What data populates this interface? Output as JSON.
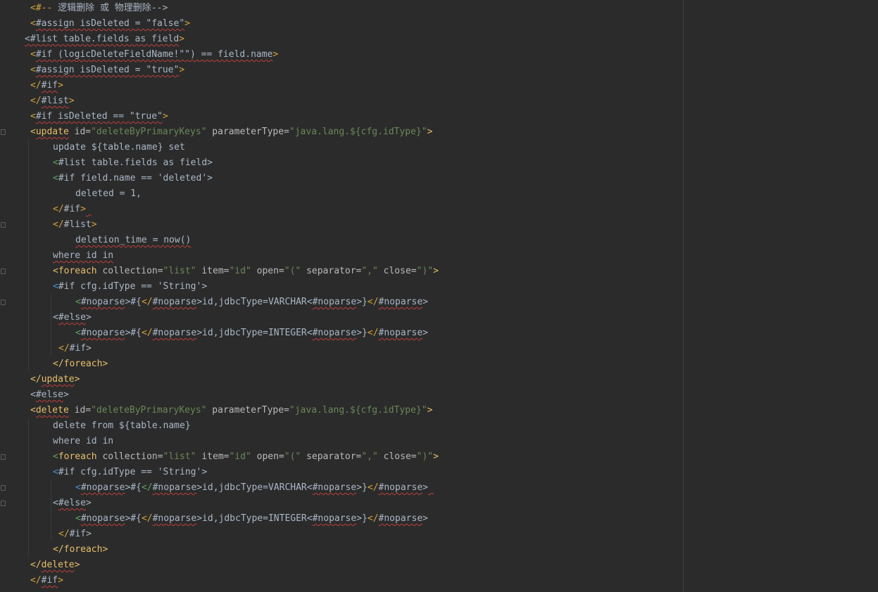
{
  "editor": {
    "lines": [
      {
        "indent": 43,
        "segs": [
          [
            "<#-- ",
            "t-ftlbr-gold"
          ],
          [
            "逻辑删除 或 物理删除",
            "t-plain"
          ],
          [
            "-->",
            "t-plain"
          ]
        ]
      },
      {
        "indent": 43,
        "segs": [
          [
            "<",
            "t-ftlbr-gold"
          ],
          [
            "#assign isDeleted = \"false\"",
            "t-plain sq"
          ],
          [
            ">",
            "t-ftlbr-gold"
          ]
        ]
      },
      {
        "indent": 35,
        "segs": [
          [
            "<#list table.fields as field",
            "t-plain sq"
          ],
          [
            ">",
            "t-ftlbr-gold"
          ]
        ]
      },
      {
        "indent": 43,
        "segs": [
          [
            "<",
            "t-ftlbr-gold"
          ],
          [
            "#if (logicDeleteFieldName!\"\") == field.name",
            "t-plain sq"
          ],
          [
            ">",
            "t-ftlbr-gold"
          ]
        ]
      },
      {
        "indent": 43,
        "segs": [
          [
            "<",
            "t-ftlbr-gold"
          ],
          [
            "#assign isDeleted = \"true\"",
            "t-plain sq"
          ],
          [
            ">",
            "t-ftlbr-gold"
          ]
        ]
      },
      {
        "indent": 43,
        "segs": [
          [
            "</",
            "t-ftlbr-gold"
          ],
          [
            "#if",
            "t-plain sq"
          ],
          [
            ">",
            "t-ftlbr-gold"
          ]
        ]
      },
      {
        "indent": 43,
        "segs": [
          [
            "</",
            "t-ftlbr-gold"
          ],
          [
            "#list",
            "t-plain sq"
          ],
          [
            ">",
            "t-ftlbr-gold"
          ]
        ]
      },
      {
        "indent": 43,
        "segs": [
          [
            "<",
            "t-ftlbr-gold"
          ],
          [
            "#if isDeleted == \"true\"",
            "t-plain sq"
          ],
          [
            ">",
            "t-ftlbr-gold"
          ]
        ]
      },
      {
        "indent": 43,
        "segs": [
          [
            "<",
            "t-tag"
          ],
          [
            "update",
            "t-tag sq"
          ],
          [
            " id=",
            "t-attr"
          ],
          [
            "\"deleteByPrimaryKeys\"",
            "t-str"
          ],
          [
            " parameterType=",
            "t-attr"
          ],
          [
            "\"java.lang.${cfg.idType}\"",
            "t-str"
          ],
          [
            ">",
            "t-tag"
          ]
        ]
      },
      {
        "indent": 75,
        "segs": [
          [
            "update ${table.name} set",
            "t-plain"
          ]
        ]
      },
      {
        "indent": 75,
        "segs": [
          [
            "<",
            "t-ftlbr-green"
          ],
          [
            "#list table.fields as field",
            "t-plain"
          ],
          [
            ">",
            "t-plain"
          ]
        ]
      },
      {
        "indent": 75,
        "segs": [
          [
            "<",
            "t-ftlbr-green"
          ],
          [
            "#if field.name == 'deleted'",
            "t-plain"
          ],
          [
            ">",
            "t-plain"
          ]
        ]
      },
      {
        "indent": 107,
        "segs": [
          [
            "deleted = 1,",
            "t-plain"
          ]
        ]
      },
      {
        "indent": 75,
        "segs": [
          [
            "</",
            "t-ftlbr-gold"
          ],
          [
            "#if",
            "t-plain"
          ],
          [
            ">",
            "t-ftlbr-gold"
          ],
          [
            " ",
            "t-plain sq"
          ]
        ]
      },
      {
        "indent": 75,
        "segs": [
          [
            "</",
            "t-ftlbr-gold"
          ],
          [
            "#list",
            "t-plain"
          ],
          [
            ">",
            "t-ftlbr-gold"
          ]
        ]
      },
      {
        "indent": 107,
        "segs": [
          [
            "deletion_time = now()",
            "t-plain sq"
          ]
        ]
      },
      {
        "indent": 75,
        "segs": [
          [
            "where id in",
            "t-plain sq"
          ]
        ]
      },
      {
        "indent": 75,
        "segs": [
          [
            "<",
            "t-tag"
          ],
          [
            "foreach",
            "t-tag"
          ],
          [
            " collection=",
            "t-attr"
          ],
          [
            "\"list\"",
            "t-str"
          ],
          [
            " item=",
            "t-attr"
          ],
          [
            "\"id\"",
            "t-str"
          ],
          [
            " open=",
            "t-attr"
          ],
          [
            "\"(\"",
            "t-str"
          ],
          [
            " separator=",
            "t-attr"
          ],
          [
            "\",\"",
            "t-str"
          ],
          [
            " close=",
            "t-attr"
          ],
          [
            "\")\"",
            "t-str"
          ],
          [
            ">",
            "t-tag"
          ]
        ]
      },
      {
        "indent": 75,
        "segs": [
          [
            "<",
            "t-ftlbr-blue"
          ],
          [
            "#if cfg.idType == 'String'",
            "t-plain"
          ],
          [
            ">",
            "t-plain"
          ]
        ]
      },
      {
        "indent": 107,
        "segs": [
          [
            "<",
            "t-ftlbr-green"
          ],
          [
            "#noparse",
            "t-plain sq"
          ],
          [
            ">#{",
            "t-plain"
          ],
          [
            "</",
            "t-ftlbr-gold"
          ],
          [
            "#noparse",
            "t-plain sq"
          ],
          [
            ">id,jdbcType=VARCHAR",
            "t-plain"
          ],
          [
            "<",
            "t-plain"
          ],
          [
            "#noparse",
            "t-plain sq"
          ],
          [
            ">}",
            "t-plain"
          ],
          [
            "</",
            "t-ftlbr-gold"
          ],
          [
            "#noparse",
            "t-plain sq"
          ],
          [
            ">",
            "t-plain"
          ]
        ]
      },
      {
        "indent": 75,
        "segs": [
          [
            "<",
            "t-plain"
          ],
          [
            "#else",
            "t-plain sq"
          ],
          [
            ">",
            "t-plain"
          ]
        ]
      },
      {
        "indent": 107,
        "segs": [
          [
            "<",
            "t-ftlbr-green"
          ],
          [
            "#noparse",
            "t-plain sq"
          ],
          [
            ">#{",
            "t-plain"
          ],
          [
            "</",
            "t-ftlbr-gold"
          ],
          [
            "#noparse",
            "t-plain sq"
          ],
          [
            ">id,jdbcType=INTEGER",
            "t-plain"
          ],
          [
            "<",
            "t-plain"
          ],
          [
            "#noparse",
            "t-plain sq"
          ],
          [
            ">}",
            "t-plain"
          ],
          [
            "</",
            "t-ftlbr-gold"
          ],
          [
            "#noparse",
            "t-plain sq"
          ],
          [
            ">",
            "t-plain"
          ]
        ]
      },
      {
        "indent": 83,
        "segs": [
          [
            "</",
            "t-ftlbr-gold"
          ],
          [
            "#if",
            "t-plain"
          ],
          [
            ">",
            "t-plain"
          ]
        ]
      },
      {
        "indent": 75,
        "segs": [
          [
            "</",
            "t-tag"
          ],
          [
            "foreach",
            "t-tag"
          ],
          [
            ">",
            "t-tag"
          ]
        ]
      },
      {
        "indent": 43,
        "segs": [
          [
            "</",
            "t-tag"
          ],
          [
            "update",
            "t-tag sq"
          ],
          [
            ">",
            "t-tag"
          ]
        ]
      },
      {
        "indent": 43,
        "segs": [
          [
            "<",
            "t-plain"
          ],
          [
            "#else",
            "t-plain sq"
          ],
          [
            ">",
            "t-plain"
          ]
        ]
      },
      {
        "indent": 43,
        "segs": [
          [
            "<",
            "t-tag"
          ],
          [
            "delete",
            "t-tag sq"
          ],
          [
            " id=",
            "t-attr"
          ],
          [
            "\"deleteByPrimaryKeys\"",
            "t-str"
          ],
          [
            " parameterType=",
            "t-attr"
          ],
          [
            "\"java.lang.${cfg.idType}\"",
            "t-str"
          ],
          [
            ">",
            "t-tag"
          ]
        ]
      },
      {
        "indent": 75,
        "segs": [
          [
            "delete from ${table.name}",
            "t-plain"
          ]
        ]
      },
      {
        "indent": 75,
        "segs": [
          [
            "where id in",
            "t-plain"
          ]
        ]
      },
      {
        "indent": 75,
        "segs": [
          [
            "<",
            "t-ftlbr-green"
          ],
          [
            "foreach",
            "t-tag"
          ],
          [
            " collection=",
            "t-attr"
          ],
          [
            "\"list\"",
            "t-str"
          ],
          [
            " item=",
            "t-attr"
          ],
          [
            "\"id\"",
            "t-str"
          ],
          [
            " open=",
            "t-attr"
          ],
          [
            "\"(\"",
            "t-str"
          ],
          [
            " separator=",
            "t-attr"
          ],
          [
            "\",\"",
            "t-str"
          ],
          [
            " close=",
            "t-attr"
          ],
          [
            "\")\"",
            "t-str"
          ],
          [
            ">",
            "t-tag"
          ]
        ]
      },
      {
        "indent": 75,
        "segs": [
          [
            "<",
            "t-ftlbr-blue"
          ],
          [
            "#if cfg.idType == 'String'",
            "t-plain"
          ],
          [
            ">",
            "t-plain"
          ]
        ]
      },
      {
        "indent": 107,
        "segs": [
          [
            "<",
            "t-ftlbr-blue"
          ],
          [
            "#noparse",
            "t-plain sq"
          ],
          [
            ">#{",
            "t-plain"
          ],
          [
            "</",
            "t-ftlbr-green"
          ],
          [
            "#noparse",
            "t-plain sq"
          ],
          [
            ">id,jdbcType=VARCHAR",
            "t-plain"
          ],
          [
            "<",
            "t-plain"
          ],
          [
            "#noparse",
            "t-plain sq"
          ],
          [
            ">}",
            "t-plain"
          ],
          [
            "</",
            "t-ftlbr-gold"
          ],
          [
            "#noparse",
            "t-plain sq"
          ],
          [
            ">",
            "t-plain"
          ],
          [
            " ",
            "t-plain sq"
          ]
        ]
      },
      {
        "indent": 75,
        "segs": [
          [
            "<",
            "t-plain"
          ],
          [
            "#else",
            "t-plain sq"
          ],
          [
            ">",
            "t-plain"
          ]
        ]
      },
      {
        "indent": 107,
        "segs": [
          [
            "<",
            "t-ftlbr-green"
          ],
          [
            "#noparse",
            "t-plain sq"
          ],
          [
            ">#{",
            "t-plain"
          ],
          [
            "</",
            "t-ftlbr-gold"
          ],
          [
            "#noparse",
            "t-plain sq"
          ],
          [
            ">id,jdbcType=INTEGER",
            "t-plain"
          ],
          [
            "<",
            "t-plain"
          ],
          [
            "#noparse",
            "t-plain sq"
          ],
          [
            ">}",
            "t-plain"
          ],
          [
            "</",
            "t-ftlbr-gold"
          ],
          [
            "#noparse",
            "t-plain sq"
          ],
          [
            ">",
            "t-plain"
          ]
        ]
      },
      {
        "indent": 83,
        "segs": [
          [
            "</",
            "t-ftlbr-gold"
          ],
          [
            "#if",
            "t-plain"
          ],
          [
            ">",
            "t-plain"
          ]
        ]
      },
      {
        "indent": 75,
        "segs": [
          [
            "</",
            "t-tag"
          ],
          [
            "foreach",
            "t-tag"
          ],
          [
            ">",
            "t-tag"
          ]
        ]
      },
      {
        "indent": 43,
        "segs": [
          [
            "</",
            "t-tag"
          ],
          [
            "delete",
            "t-tag sq"
          ],
          [
            ">",
            "t-tag"
          ]
        ]
      },
      {
        "indent": 43,
        "segs": [
          [
            "</",
            "t-ftlbr-gold"
          ],
          [
            "#if",
            "t-plain sq"
          ],
          [
            ">",
            "t-ftlbr-gold"
          ]
        ]
      }
    ]
  },
  "theme": {
    "background": "#2b2b2b",
    "text": "#a9b7c6",
    "tag": "#e8bf6a",
    "string": "#6a8759",
    "squiggle": "#bc3f3c"
  }
}
